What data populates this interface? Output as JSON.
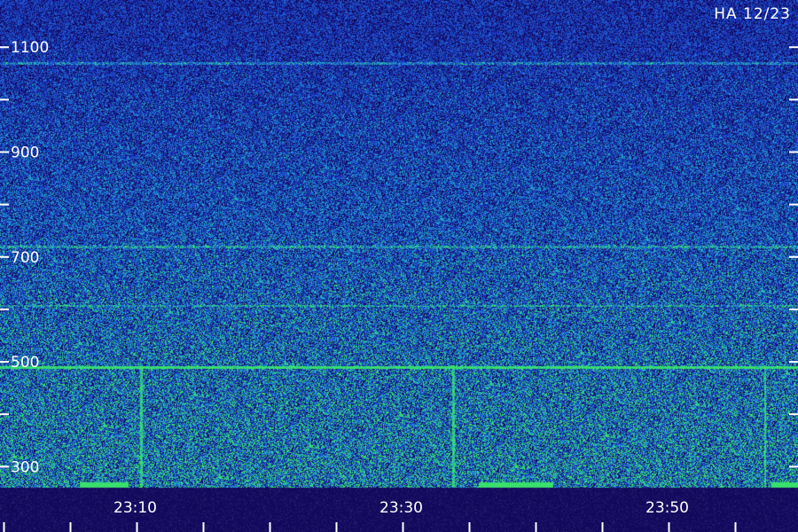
{
  "station_label": "HA 12/23",
  "chart_data": {
    "type": "heatmap",
    "title": "",
    "xlabel": "",
    "ylabel": "",
    "x_ticks": [
      "23:10",
      "23:30",
      "23:50"
    ],
    "x_tick_minutes": [
      10,
      30,
      50
    ],
    "x_minutes_range": [
      -0.3,
      59.7
    ],
    "x_minor_tick_every_min": 5,
    "y_ticks": [
      300,
      500,
      700,
      900,
      1100
    ],
    "y_minor_ticks": [
      400,
      600,
      800,
      1000,
      1200
    ],
    "ylim": [
      260,
      1190
    ],
    "colormap": [
      "#12085c",
      "#1a2fb8",
      "#1f5fd0",
      "#22a8c8",
      "#39e06a"
    ],
    "features": {
      "steady_lines_hz": [
        490,
        607,
        720,
        1070
      ],
      "strong_line_hz": 490,
      "vertical_spikes_min": [
        10.3,
        33.8,
        57.2
      ],
      "low_band_bursts_min": [
        [
          5.7,
          9.3
        ],
        [
          35.7,
          41.3
        ],
        [
          57.7,
          59.7
        ]
      ]
    }
  }
}
